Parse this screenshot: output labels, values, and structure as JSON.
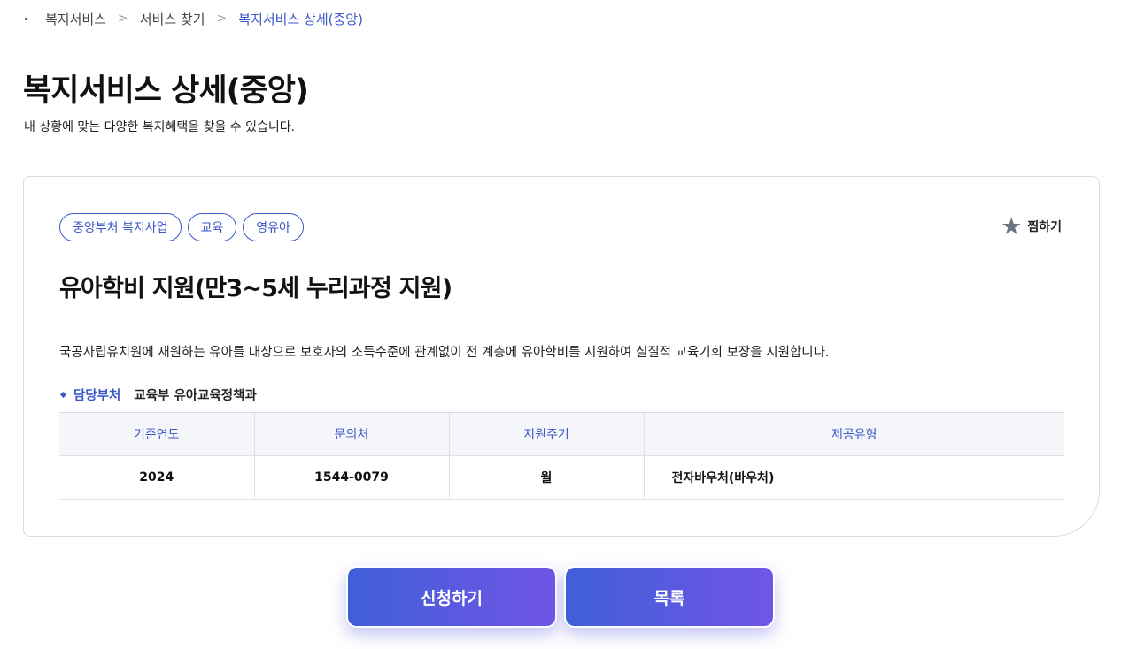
{
  "breadcrumb": {
    "items": [
      "복지서비스",
      "서비스 찾기",
      "복지서비스 상세(중앙)"
    ]
  },
  "page": {
    "title": "복지서비스 상세(중앙)",
    "subtitle": "내 상황에 맞는 다양한 복지혜택을 찾을 수 있습니다."
  },
  "service": {
    "tags": [
      "중앙부처 복지사업",
      "교육",
      "영유아"
    ],
    "favorite_label": "찜하기",
    "title": "유아학비 지원(만3~5세 누리과정 지원)",
    "description": "국공사립유치원에 재원하는 유아를 대상으로 보호자의 소득수준에 관계없이 전 계층에 유아학비를 지원하여 실질적 교육기회 보장을 지원합니다.",
    "department_label": "담당부처",
    "department_value": "교육부 유아교육정책과"
  },
  "table": {
    "headers": [
      "기준연도",
      "문의처",
      "지원주기",
      "제공유형"
    ],
    "row": [
      "2024",
      "1544-0079",
      "월",
      "전자바우처(바우처)"
    ]
  },
  "actions": {
    "apply_label": "신청하기",
    "list_label": "목록"
  },
  "colors": {
    "accent": "#3b57c8",
    "button_gradient_start": "#3f5fd8",
    "button_gradient_end": "#7155e6",
    "star": "#6f7485"
  },
  "icons": {
    "favorite": "star-icon",
    "breadcrumb_separator": "chevron-right-icon"
  }
}
